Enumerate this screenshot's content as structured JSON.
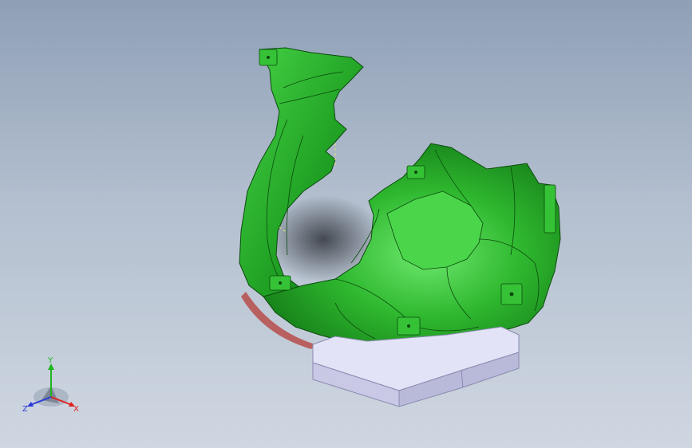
{
  "viewport": {
    "background_top": "#8fa0b6",
    "background_bottom": "#cfd7e1"
  },
  "model": {
    "part_color": "#1fa21f",
    "part_highlight": "#5fe35f",
    "part_shadow": "#0c6a10",
    "block_color": "#dcdcf4",
    "gasket_color": "#c46a6a"
  },
  "triad": {
    "y_label": "Y",
    "x_label": "X",
    "z_label": "Z",
    "y_color": "#1fb51f",
    "x_color": "#e02020",
    "z_color": "#2a3ad8"
  }
}
